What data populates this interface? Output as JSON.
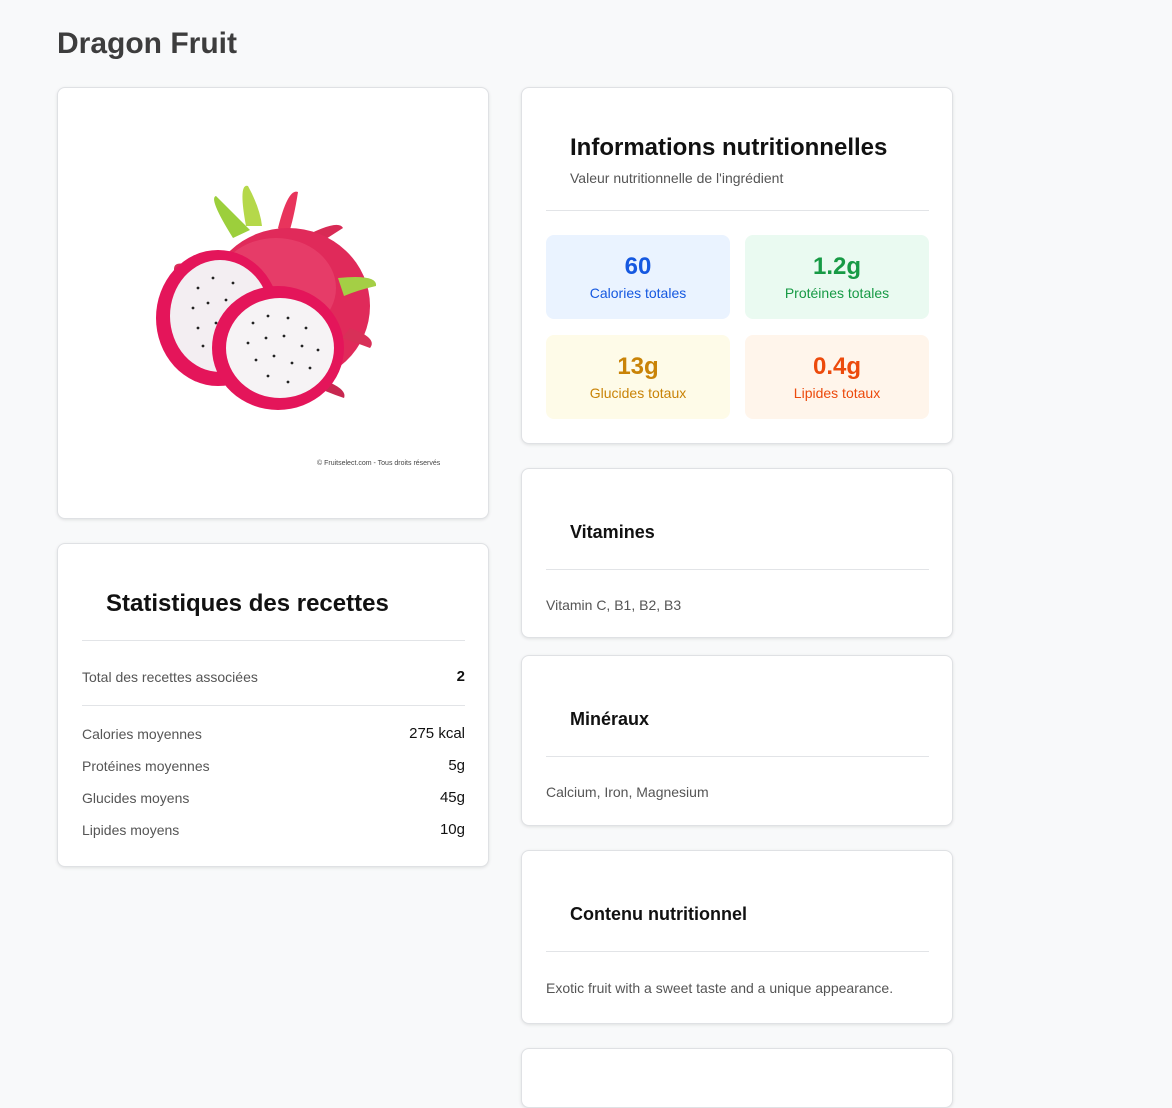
{
  "page": {
    "title": "Dragon Fruit"
  },
  "image": {
    "alt": "Dragon Fruit",
    "credit": "© Fruitselect.com - Tous droits réservés"
  },
  "stats": {
    "title": "Statistiques des recettes",
    "total_label": "Total des recettes associées",
    "total_value": "2",
    "rows": [
      {
        "label": "Calories moyennes",
        "value": "275 kcal"
      },
      {
        "label": "Protéines moyennes",
        "value": "5g"
      },
      {
        "label": "Glucides moyens",
        "value": "45g"
      },
      {
        "label": "Lipides moyens",
        "value": "10g"
      }
    ]
  },
  "nutrition": {
    "title": "Informations nutritionnelles",
    "subtitle": "Valeur nutritionnelle de l'ingrédient",
    "tiles": [
      {
        "value": "60",
        "label": "Calories totales",
        "color": "#1558e0",
        "bg": "#eaf3ff"
      },
      {
        "value": "1.2g",
        "label": "Protéines totales",
        "color": "#179a45",
        "bg": "#eafaf1"
      },
      {
        "value": "13g",
        "label": "Glucides totaux",
        "color": "#c98307",
        "bg": "#fefbe8"
      },
      {
        "value": "0.4g",
        "label": "Lipides totaux",
        "color": "#ec4a0c",
        "bg": "#fff5eb"
      }
    ]
  },
  "vitamins": {
    "title": "Vitamines",
    "text": "Vitamin C, B1, B2, B3"
  },
  "minerals": {
    "title": "Minéraux",
    "text": "Calcium, Iron, Magnesium"
  },
  "content": {
    "title": "Contenu nutritionnel",
    "text": "Exotic fruit with a sweet taste and a unique appearance."
  }
}
